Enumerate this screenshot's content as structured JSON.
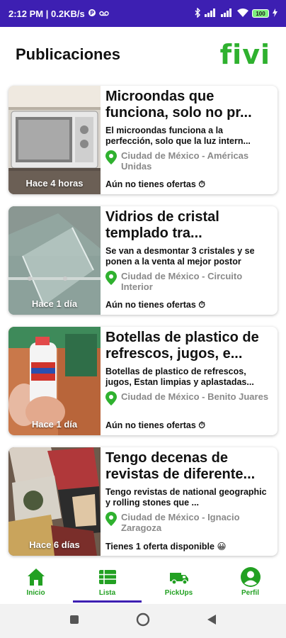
{
  "status_bar": {
    "time_speed": "2:12 PM | 0.2KB/s",
    "battery": "100"
  },
  "header": {
    "title": "Publicaciones",
    "brand": "fivi"
  },
  "colors": {
    "status_bar": "#3d1fb2",
    "brand_green": "#2fb12f",
    "nav_green": "#22a022",
    "active_indicator": "#3d1fb2"
  },
  "posts": [
    {
      "title": "Microondas que funciona, solo no pr...",
      "description": "El microondas funciona a la perfección, solo que la luz intern...",
      "location": "Ciudad de México - Américas Unidas",
      "age": "Hace 4 horas",
      "offers": "Aún no tienes ofertas ⏱",
      "image": "microwave-photo"
    },
    {
      "title": "Vidrios de cristal templado tra...",
      "description": "Se van a desmontar 3 cristales y se ponen a la venta al mejor postor",
      "location": "Ciudad de México - Circuito Interior",
      "age": "Hace 1 día",
      "offers": "Aún no tienes ofertas ⏱",
      "image": "glass-photo"
    },
    {
      "title": "Botellas de plastico de refrescos, jugos, e...",
      "description": "Botellas de plastico de refrescos, jugos, Estan limpias y aplastadas...",
      "location": "Ciudad de México - Benito Juares",
      "age": "Hace 1 día",
      "offers": "Aún no tienes ofertas ⏱",
      "image": "bottle-photo"
    },
    {
      "title": "Tengo decenas de revistas de diferente...",
      "description": "Tengo revistas de national geographic y rolling stones que ...",
      "location": "Ciudad de México - Ignacio Zaragoza",
      "age": "Hace 6 días",
      "offers": "Tienes 1 oferta disponible 😀",
      "image": "magazines-photo"
    }
  ],
  "bottom_nav": [
    {
      "label": "Inicio",
      "icon": "home-icon"
    },
    {
      "label": "Lista",
      "icon": "list-icon",
      "active": true
    },
    {
      "label": "PickUps",
      "icon": "truck-icon"
    },
    {
      "label": "Perfil",
      "icon": "profile-icon"
    }
  ]
}
